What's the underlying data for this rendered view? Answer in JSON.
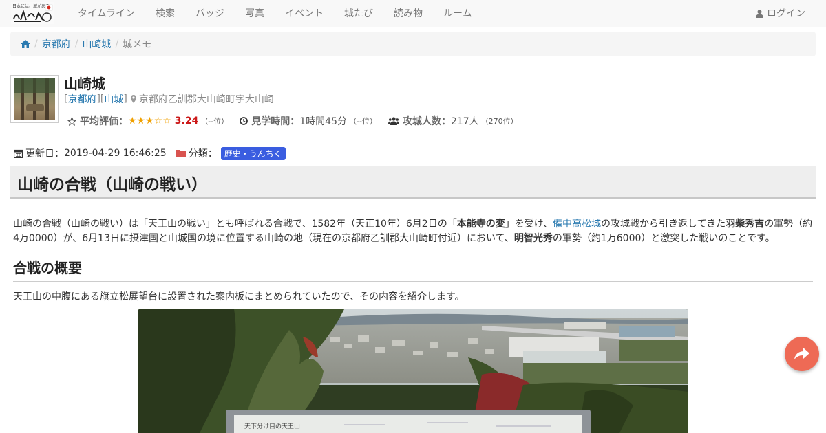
{
  "header": {
    "logo_icon": "site-logo",
    "nav": [
      "タイムライン",
      "検索",
      "バッジ",
      "写真",
      "イベント",
      "城たび",
      "読み物",
      "ルーム"
    ],
    "login": "ログイン",
    "login_icon": "user-icon"
  },
  "breadcrumb": {
    "home_icon": "home-icon",
    "items": [
      "京都府",
      "山崎城"
    ],
    "current": "城メモ"
  },
  "castle": {
    "name": "山崎城",
    "prefecture": "京都府",
    "province": "山城",
    "address": "京都府乙訓郡大山崎町字大山崎",
    "rating_label": "平均評価：",
    "stars": "★★★☆☆",
    "score": "3.24",
    "score_rank": "（--位）",
    "visit_label": "見学時間：",
    "visit_time": "1時間45分",
    "visit_rank": "（--位）",
    "visitors_label": "攻城人数：",
    "visitors": "217人",
    "visitors_rank": "（270位）"
  },
  "meta": {
    "updated_label": "更新日：",
    "updated": "2019-04-29 16:46:25",
    "category_label": "分類：",
    "category": "歴史・うんちく"
  },
  "article": {
    "title": "山崎の合戦（山崎の戦い）",
    "p1": [
      "山崎の合戦（山崎の戦い）は「天王山の戦い」とも呼ばれる合戦で、1582年（天正10年）6月2日の「",
      "本能寺の変",
      "」を受け、",
      "備中高松城",
      "の攻城戦から引き返してきた",
      "羽柴秀吉",
      "の軍勢（約4万0000）が、6月13日に摂津国と山城国の境に位置する山崎の地（現在の京都府乙訓郡大山崎町付近）において、",
      "明智光秀",
      "の軍勢（約1万6000）と激突した戦いのことです。"
    ],
    "h2": "合戦の概要",
    "p2": "天王山の中腹にある旗立松展望台に設置された案内板にまとめられていたので、その内容を紹介します。",
    "sign_text": "天下分け目の天王山"
  },
  "colors": {
    "accent_link": "#2a7ab0",
    "star": "#f0a000",
    "score": "#cc1a1a",
    "tag": "#3a5de0",
    "fab": "#ee6a55"
  }
}
